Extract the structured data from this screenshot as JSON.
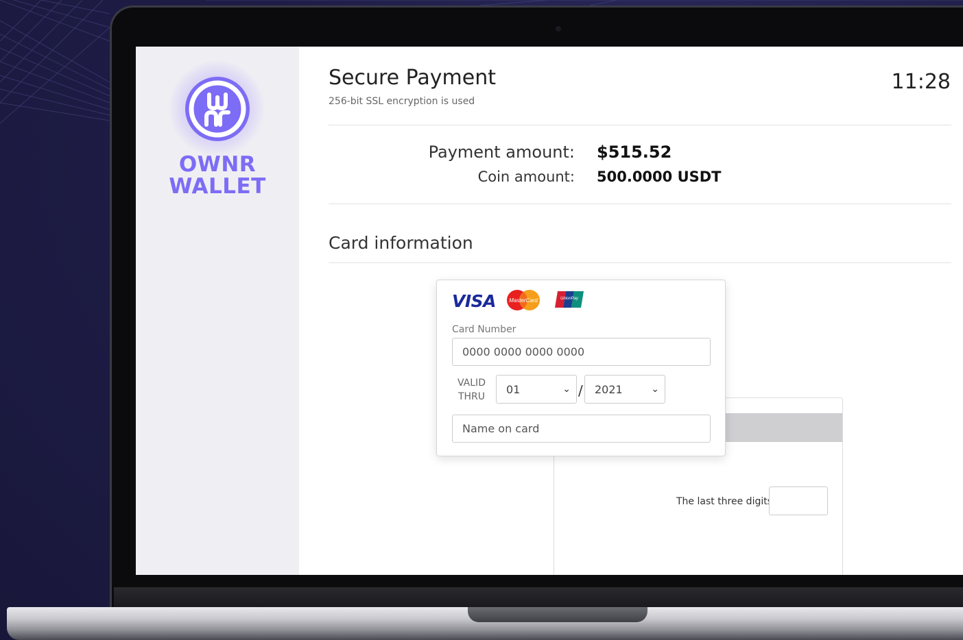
{
  "app": {
    "brand_line1": "OWNR",
    "brand_line2": "WALLET",
    "logo_icon": "ownr-logo-icon"
  },
  "header": {
    "title": "Secure Payment",
    "subtitle": "256-bit SSL encryption is used",
    "time": "11:28"
  },
  "payment": {
    "amount_label": "Payment amount:",
    "amount_value": "$515.52",
    "coin_label": "Coin amount:",
    "coin_value": "500.0000 USDT"
  },
  "card_section": {
    "title": "Card information",
    "brands": [
      "VISA",
      "MasterCard",
      "UnionPay"
    ],
    "visa_label": "VISA",
    "mc_label": "MasterCard",
    "up_label": "UnionPay",
    "number_label": "Card Number",
    "number_placeholder": "0000 0000 0000 0000",
    "valid_label_1": "VALID",
    "valid_label_2": "THRU",
    "month_value": "01",
    "year_value": "2021",
    "separator": "/",
    "name_placeholder": "Name on card",
    "cvv_label": "The last three digits"
  },
  "colors": {
    "brand": "#7d6cf5",
    "visa": "#1a2a9a"
  }
}
